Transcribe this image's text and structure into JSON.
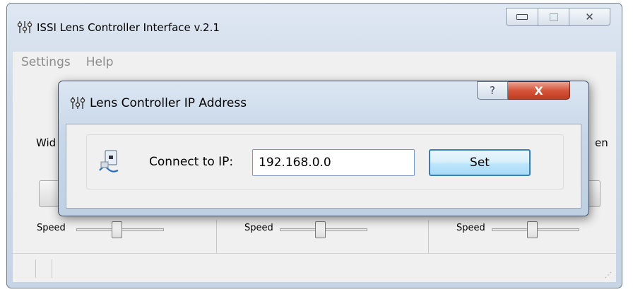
{
  "main_window": {
    "title": "ISSI Lens Controller Interface v.2.1",
    "icon": "lens-controller-icon",
    "controls": {
      "minimize": "▭",
      "maximize": "▢",
      "close": "✕"
    },
    "menu": {
      "settings": "Settings",
      "help": "Help"
    },
    "label_left_partial": "Wid",
    "label_right_partial": "en",
    "speed_left": "Speed",
    "speed_middle": "Speed",
    "speed_right": "Speed",
    "slider_positions": [
      0.45,
      0.45,
      0.45
    ]
  },
  "dialog": {
    "title": "Lens Controller IP Address",
    "icon": "lens-controller-icon",
    "help_glyph": "?",
    "close_glyph": "X",
    "network_icon": "network-connection-icon",
    "ip_label": "Connect to IP:",
    "ip_value": "192.168.0.0",
    "set_label": "Set"
  },
  "colors": {
    "title_frame": "#c6d4e5",
    "close_red": "#c23a20",
    "set_focus_border": "#3c7fb1"
  }
}
